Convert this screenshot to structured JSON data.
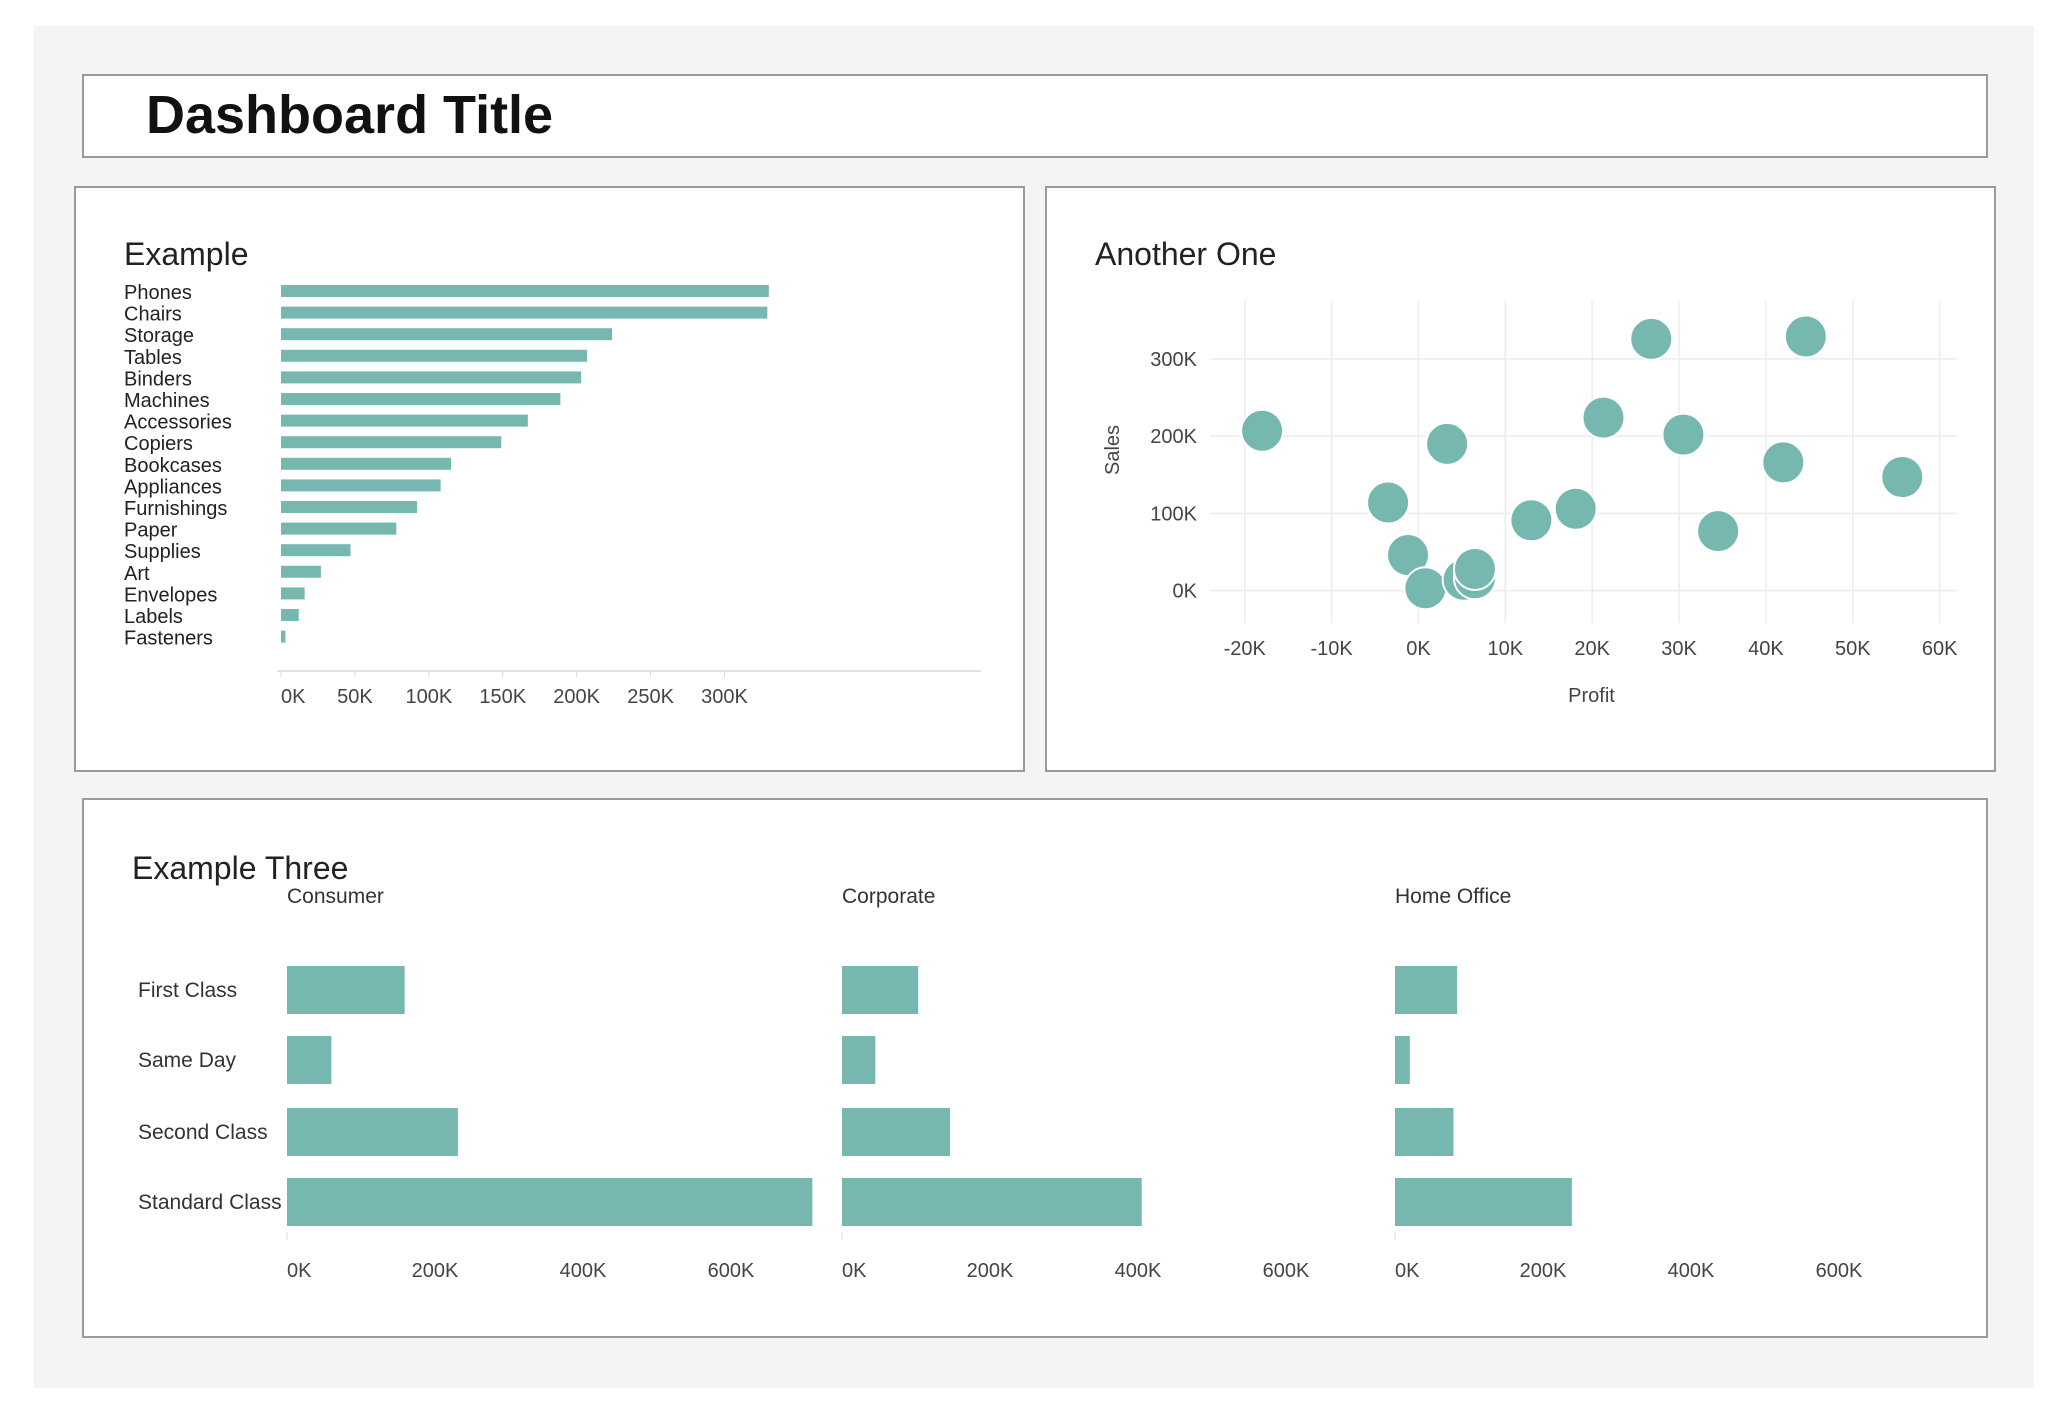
{
  "dashboard": {
    "title": "Dashboard Title"
  },
  "colors": {
    "accent": "#76b7b0",
    "grid": "#ececec",
    "border": "#9a9a9a"
  },
  "chart_data": [
    {
      "type": "bar",
      "title": "Example",
      "orientation": "horizontal",
      "categories": [
        "Phones",
        "Chairs",
        "Storage",
        "Tables",
        "Binders",
        "Machines",
        "Accessories",
        "Copiers",
        "Bookcases",
        "Appliances",
        "Furnishings",
        "Paper",
        "Supplies",
        "Art",
        "Envelopes",
        "Labels",
        "Fasteners"
      ],
      "values": [
        330000,
        329000,
        224000,
        207000,
        203000,
        189000,
        167000,
        149000,
        115000,
        108000,
        92000,
        78000,
        47000,
        27000,
        16000,
        12000,
        3000
      ],
      "xlim": [
        0,
        345000
      ],
      "xticks": [
        0,
        50000,
        100000,
        150000,
        200000,
        250000,
        300000
      ],
      "xtick_labels": [
        "0K",
        "50K",
        "100K",
        "150K",
        "200K",
        "250K",
        "300K"
      ],
      "grid": false
    },
    {
      "type": "scatter",
      "title": "Another One",
      "xlabel": "Profit",
      "ylabel": "Sales",
      "xlim": [
        -24000,
        62000
      ],
      "ylim": [
        -42000,
        375000
      ],
      "xticks": [
        -20000,
        -10000,
        0,
        10000,
        20000,
        30000,
        40000,
        50000,
        60000
      ],
      "xtick_labels": [
        "-20K",
        "-10K",
        "0K",
        "10K",
        "20K",
        "30K",
        "40K",
        "50K",
        "60K"
      ],
      "yticks": [
        0,
        100000,
        200000,
        300000
      ],
      "ytick_labels": [
        "0K",
        "100K",
        "200K",
        "300K"
      ],
      "grid": true,
      "points": [
        {
          "x": -18000,
          "y": 207000
        },
        {
          "x": -3500,
          "y": 114000
        },
        {
          "x": -1200,
          "y": 46000
        },
        {
          "x": 800,
          "y": 3000
        },
        {
          "x": 3300,
          "y": 190000
        },
        {
          "x": 5200,
          "y": 14000
        },
        {
          "x": 6500,
          "y": 16000
        },
        {
          "x": 6500,
          "y": 28000
        },
        {
          "x": 13000,
          "y": 91000
        },
        {
          "x": 18100,
          "y": 106000
        },
        {
          "x": 21300,
          "y": 224000
        },
        {
          "x": 26800,
          "y": 326000
        },
        {
          "x": 30500,
          "y": 202000
        },
        {
          "x": 34500,
          "y": 77000
        },
        {
          "x": 42000,
          "y": 166000
        },
        {
          "x": 44600,
          "y": 329000
        },
        {
          "x": 55700,
          "y": 147000
        }
      ]
    },
    {
      "type": "bar",
      "title": "Example Three",
      "orientation": "horizontal",
      "categories": [
        "First Class",
        "Same Day",
        "Second Class",
        "Standard Class"
      ],
      "series": [
        {
          "name": "Consumer",
          "values": [
            159000,
            60000,
            231000,
            710000
          ]
        },
        {
          "name": "Corporate",
          "values": [
            103000,
            45000,
            146000,
            405000
          ]
        },
        {
          "name": "Home Office",
          "values": [
            84000,
            20000,
            79000,
            239000
          ]
        }
      ],
      "xlim": [
        0,
        720000
      ],
      "xticks": [
        0,
        200000,
        400000,
        600000
      ],
      "xtick_labels": [
        "0K",
        "200K",
        "400K",
        "600K"
      ],
      "grid": false
    }
  ]
}
